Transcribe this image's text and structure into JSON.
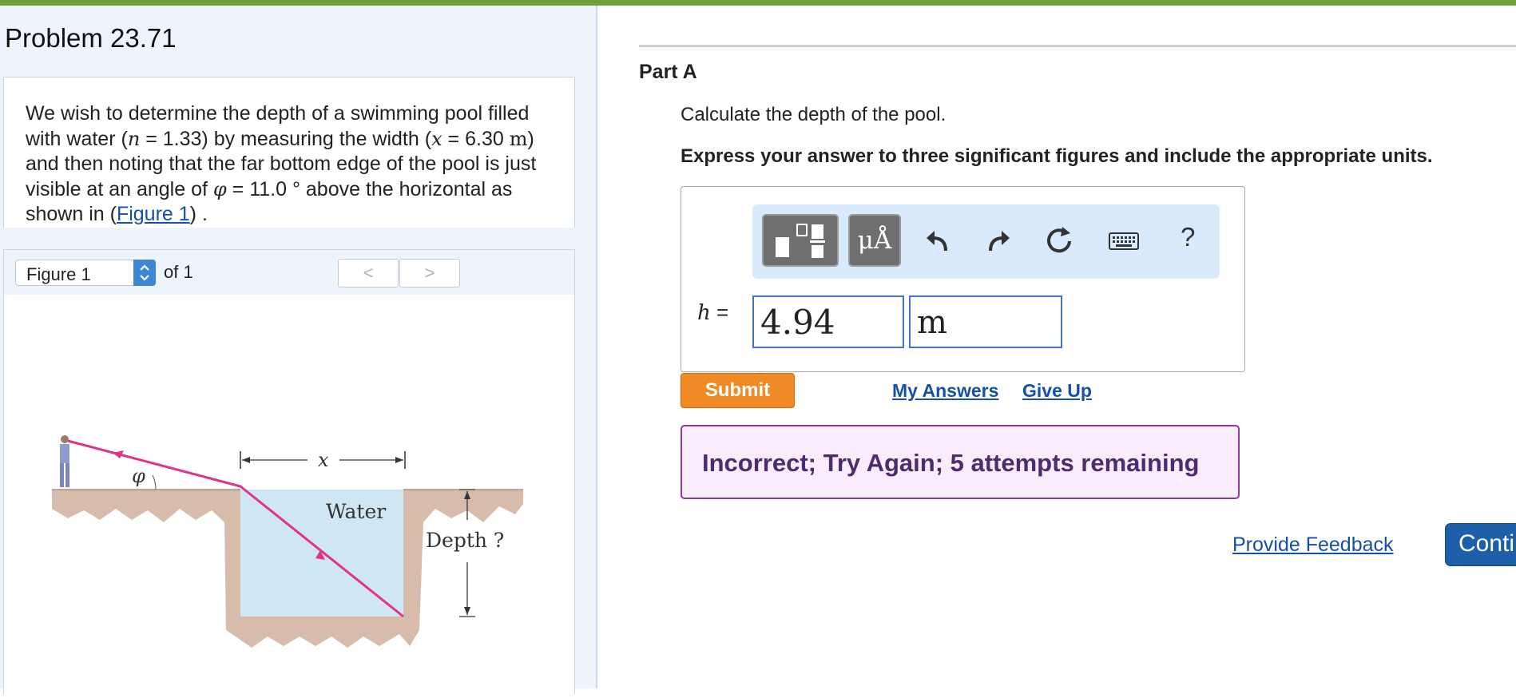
{
  "problem": {
    "title": "Problem 23.71",
    "text_1": "We wish to determine the depth of a swimming pool filled with water (",
    "var_n": "n",
    "text_2": " = 1.33) by measuring the width (",
    "var_x": "x",
    "text_3": " = 6.30 ",
    "unit_m": "m",
    "text_4": ") and then noting that the far bottom edge of the pool is just visible at an angle of ",
    "var_phi": "φ",
    "text_5": " = 11.0 ° above the horizontal as shown in (",
    "figure_link": "Figure 1",
    "text_6": ") ."
  },
  "figure_nav": {
    "selected": "Figure 1",
    "of_label": "of 1",
    "prev": "<",
    "next": ">"
  },
  "figure": {
    "phi_label": "φ",
    "x_label": "x",
    "water_label": "Water",
    "depth_label": "Depth ?",
    "colors": {
      "water": "#cfe7f5",
      "ray": "#e0338a",
      "ground": "#c9a58f"
    }
  },
  "part": {
    "title": "Part A",
    "prompt": "Calculate the depth of the pool.",
    "instruction": "Express your answer to three significant figures and include the appropriate units."
  },
  "toolbar": {
    "units_label": "μÅ",
    "help_label": "?",
    "icons": [
      "templates-icon",
      "units-icon",
      "undo-icon",
      "redo-icon",
      "reset-icon",
      "keyboard-icon",
      "help-icon"
    ]
  },
  "answer": {
    "var_label": "h",
    "equals": " =",
    "value": "4.94",
    "unit": "m"
  },
  "actions": {
    "submit": "Submit",
    "my_answers": "My Answers",
    "give_up": "Give Up"
  },
  "feedback": {
    "message": "Incorrect; Try Again; 5 attempts remaining",
    "provide_feedback": "Provide Feedback",
    "continue": "Continue"
  },
  "colors": {
    "top_bar": "#6ea13a",
    "submit": "#f08a24",
    "link": "#1550a8",
    "feedback_border": "#8a3c97",
    "continue": "#1d5fa8"
  }
}
